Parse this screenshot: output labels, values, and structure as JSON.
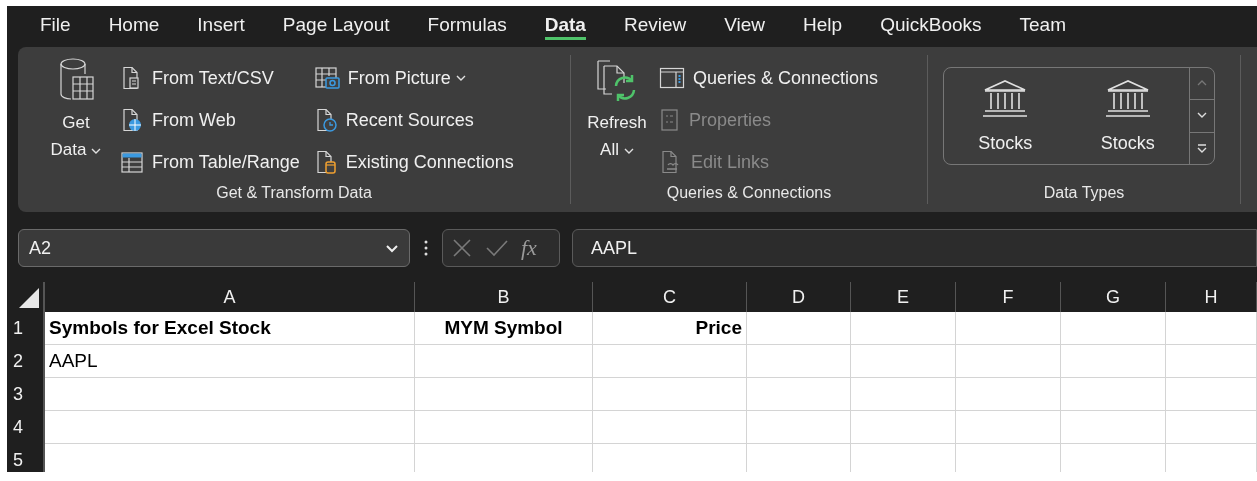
{
  "menu_tabs": [
    {
      "label": "File",
      "selected": false
    },
    {
      "label": "Home",
      "selected": false
    },
    {
      "label": "Insert",
      "selected": false
    },
    {
      "label": "Page Layout",
      "selected": false
    },
    {
      "label": "Formulas",
      "selected": false
    },
    {
      "label": "Data",
      "selected": true
    },
    {
      "label": "Review",
      "selected": false
    },
    {
      "label": "View",
      "selected": false
    },
    {
      "label": "Help",
      "selected": false
    },
    {
      "label": "QuickBooks",
      "selected": false
    },
    {
      "label": "Team",
      "selected": false
    }
  ],
  "ribbon": {
    "groups": [
      {
        "title": "Get & Transform Data",
        "kind": "commands",
        "large_button": {
          "label": "Get Data",
          "dropdown": true
        },
        "columns": [
          [
            {
              "label": "From Text/CSV",
              "dropdown": false,
              "disabled": false
            },
            {
              "label": "From Web",
              "dropdown": false,
              "disabled": false
            },
            {
              "label": "From Table/Range",
              "dropdown": false,
              "disabled": false
            }
          ],
          [
            {
              "label": "From Picture",
              "dropdown": true,
              "disabled": false
            },
            {
              "label": "Recent Sources",
              "dropdown": false,
              "disabled": false
            },
            {
              "label": "Existing Connections",
              "dropdown": false,
              "disabled": false
            }
          ]
        ]
      },
      {
        "title": "Queries & Connections",
        "kind": "commands",
        "large_button": {
          "label": "Refresh All",
          "dropdown": true
        },
        "columns": [
          [
            {
              "label": "Queries & Connections",
              "dropdown": false,
              "disabled": false
            },
            {
              "label": "Properties",
              "dropdown": false,
              "disabled": true
            },
            {
              "label": "Edit Links",
              "dropdown": false,
              "disabled": true
            }
          ]
        ]
      },
      {
        "title": "Data Types",
        "kind": "gallery",
        "items": [
          "Stocks",
          "Stocks"
        ]
      }
    ]
  },
  "formula_bar": {
    "name_box": "A2",
    "function_label": "fx",
    "formula": "AAPL"
  },
  "sheet": {
    "columns": [
      "A",
      "B",
      "C",
      "D",
      "E",
      "F",
      "G",
      "H"
    ],
    "rows": [
      {
        "label": "1",
        "cells": [
          {
            "text": "Symbols for Excel Stock",
            "centered": false,
            "right_aligned": false,
            "bold": true
          },
          {
            "text": "MYM Symbol",
            "centered": true,
            "right_aligned": false,
            "bold": true
          },
          {
            "text": "Price",
            "centered": false,
            "right_aligned": true,
            "bold": true
          }
        ]
      },
      {
        "label": "2",
        "cells": [
          {
            "text": "AAPL",
            "centered": false,
            "right_aligned": false,
            "bold": false
          }
        ]
      },
      {
        "label": "3"
      },
      {
        "label": "4"
      },
      {
        "label": "5"
      }
    ]
  }
}
